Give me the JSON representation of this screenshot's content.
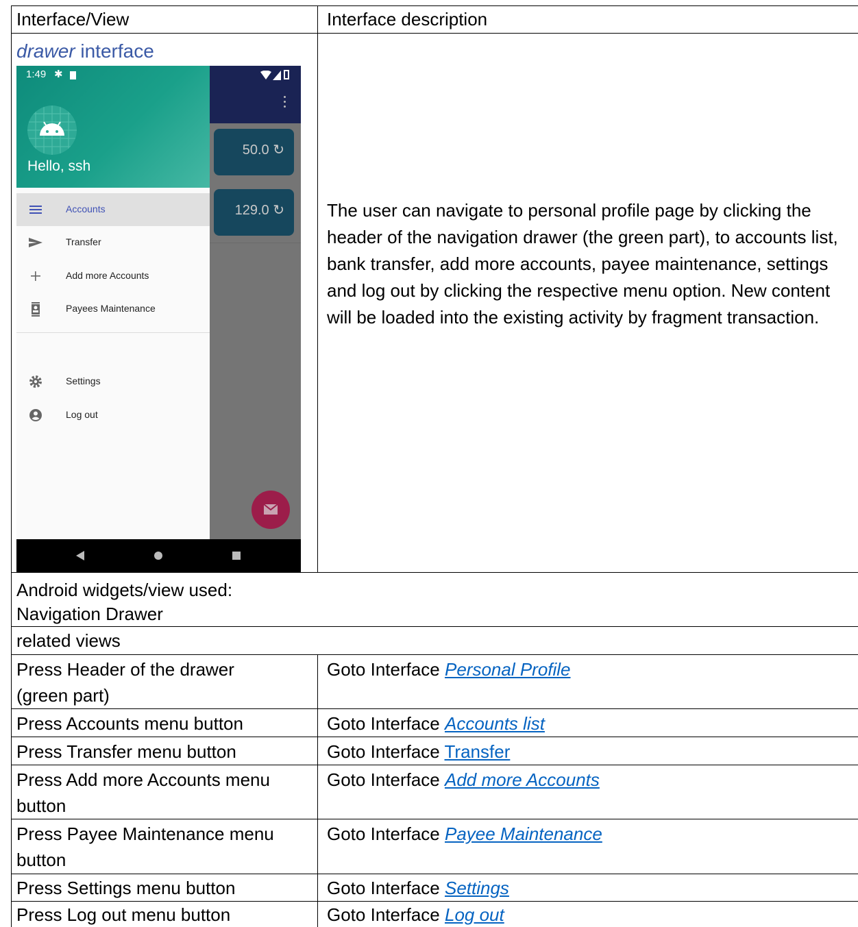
{
  "header": {
    "col1": "Interface/View",
    "col2": "Interface description"
  },
  "view_title": {
    "emph": "drawer",
    "rest": " interface"
  },
  "phone": {
    "status_time": "1:49",
    "greeting": "Hello, ssh",
    "balances": [
      "50.0",
      "129.0"
    ],
    "menu": [
      {
        "label": "Accounts",
        "icon": "menu-icon",
        "selected": true
      },
      {
        "label": "Transfer",
        "icon": "send-icon"
      },
      {
        "label": "Add more Accounts",
        "icon": "plus-icon"
      },
      {
        "label": "Payees Maintenance",
        "icon": "contact-card-icon"
      }
    ],
    "menu2": [
      {
        "label": "Settings",
        "icon": "gear-icon"
      },
      {
        "label": "Log out",
        "icon": "account-circle-icon"
      }
    ]
  },
  "description": "The user can navigate to personal profile page by clicking the header of the navigation drawer (the green part), to accounts list, bank transfer, add more accounts, payee maintenance, settings and log out by clicking the respective menu option. New content will be loaded into the existing activity by fragment transaction.",
  "widgets": {
    "line1": "Android widgets/view used:",
    "line2": "Navigation Drawer"
  },
  "related_title": "related views",
  "related": [
    {
      "action1": "Press Header of the drawer",
      "action2": "(green part)",
      "goto": "Goto Interface ",
      "link": "Personal Profile"
    },
    {
      "action1": "Press Accounts menu button",
      "goto": "Goto Interface ",
      "link": "Accounts list"
    },
    {
      "action1": "Press Transfer menu button",
      "goto": "Goto Interface ",
      "link": "Transfer"
    },
    {
      "action1": "Press Add more Accounts menu",
      "action2": "button",
      "goto": "Goto Interface ",
      "link": "Add more Accounts"
    },
    {
      "action1": "Press Payee Maintenance menu",
      "action2": "button",
      "goto": "Goto Interface ",
      "link": "Payee Maintenance"
    },
    {
      "action1": "Press Settings menu button",
      "goto": "Goto Interface ",
      "link": "Settings"
    },
    {
      "action1": "Press Log out menu button",
      "goto": "Goto Interface ",
      "link": "Log out"
    }
  ]
}
